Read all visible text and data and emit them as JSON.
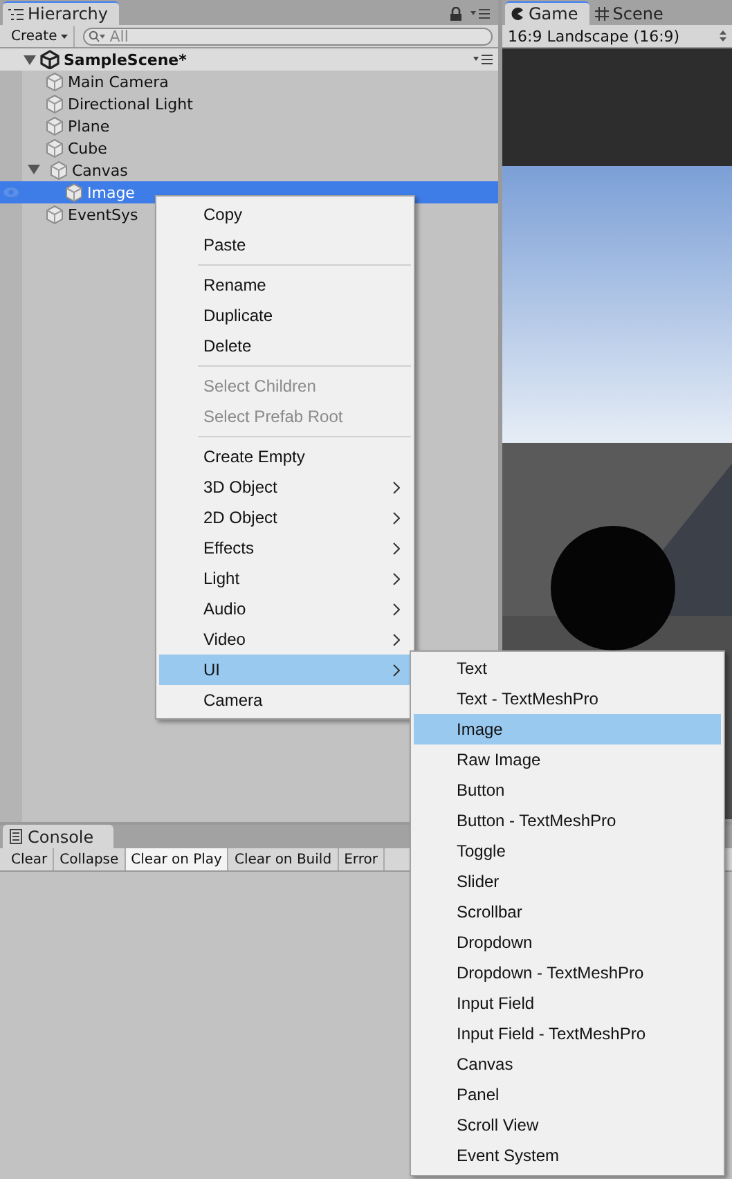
{
  "hierarchy": {
    "title": "Hierarchy",
    "create_button": "Create",
    "search_placeholder": "All",
    "scene": {
      "name": "SampleScene*",
      "expanded": true
    },
    "items": [
      {
        "label": "Main Camera",
        "selected": false
      },
      {
        "label": "Directional Light",
        "selected": false
      },
      {
        "label": "Plane",
        "selected": false
      },
      {
        "label": "Cube",
        "selected": false
      },
      {
        "label": "Canvas",
        "selected": false,
        "expanded": true,
        "children": [
          {
            "label": "Image",
            "selected": true
          }
        ]
      },
      {
        "label": "EventSys",
        "selected": false
      }
    ]
  },
  "game": {
    "tabs": [
      {
        "label": "Game",
        "kind": "game",
        "selected": true
      },
      {
        "label": "Scene",
        "kind": "scene",
        "selected": false
      }
    ],
    "aspect": "16:9 Landscape (16:9)"
  },
  "console": {
    "title": "Console",
    "buttons": [
      {
        "label": "Clear",
        "selected": false
      },
      {
        "label": "Collapse",
        "selected": false
      },
      {
        "label": "Clear on Play",
        "selected": true
      },
      {
        "label": "Clear on Build",
        "selected": false
      },
      {
        "label": "Error",
        "selected": false
      }
    ]
  },
  "context_menu": {
    "items": [
      {
        "kind": "item",
        "label": "Copy",
        "disabled": false,
        "submenu": false,
        "selected": false
      },
      {
        "kind": "item",
        "label": "Paste",
        "disabled": false,
        "submenu": false,
        "selected": false
      },
      {
        "kind": "separator"
      },
      {
        "kind": "item",
        "label": "Rename",
        "disabled": false,
        "submenu": false,
        "selected": false
      },
      {
        "kind": "item",
        "label": "Duplicate",
        "disabled": false,
        "submenu": false,
        "selected": false
      },
      {
        "kind": "item",
        "label": "Delete",
        "disabled": false,
        "submenu": false,
        "selected": false
      },
      {
        "kind": "separator"
      },
      {
        "kind": "item",
        "label": "Select Children",
        "disabled": true,
        "submenu": false,
        "selected": false
      },
      {
        "kind": "item",
        "label": "Select Prefab Root",
        "disabled": true,
        "submenu": false,
        "selected": false
      },
      {
        "kind": "separator"
      },
      {
        "kind": "item",
        "label": "Create Empty",
        "disabled": false,
        "submenu": false,
        "selected": false
      },
      {
        "kind": "item",
        "label": "3D Object",
        "disabled": false,
        "submenu": true,
        "selected": false
      },
      {
        "kind": "item",
        "label": "2D Object",
        "disabled": false,
        "submenu": true,
        "selected": false
      },
      {
        "kind": "item",
        "label": "Effects",
        "disabled": false,
        "submenu": true,
        "selected": false
      },
      {
        "kind": "item",
        "label": "Light",
        "disabled": false,
        "submenu": true,
        "selected": false
      },
      {
        "kind": "item",
        "label": "Audio",
        "disabled": false,
        "submenu": true,
        "selected": false
      },
      {
        "kind": "item",
        "label": "Video",
        "disabled": false,
        "submenu": true,
        "selected": false
      },
      {
        "kind": "item",
        "label": "UI",
        "disabled": false,
        "submenu": true,
        "selected": true
      },
      {
        "kind": "item",
        "label": "Camera",
        "disabled": false,
        "submenu": false,
        "selected": false
      }
    ]
  },
  "submenu": {
    "items": [
      {
        "label": "Text",
        "selected": false
      },
      {
        "label": "Text - TextMeshPro",
        "selected": false
      },
      {
        "label": "Image",
        "selected": true
      },
      {
        "label": "Raw Image",
        "selected": false
      },
      {
        "label": "Button",
        "selected": false
      },
      {
        "label": "Button - TextMeshPro",
        "selected": false
      },
      {
        "label": "Toggle",
        "selected": false
      },
      {
        "label": "Slider",
        "selected": false
      },
      {
        "label": "Scrollbar",
        "selected": false
      },
      {
        "label": "Dropdown",
        "selected": false
      },
      {
        "label": "Dropdown - TextMeshPro",
        "selected": false
      },
      {
        "label": "Input Field",
        "selected": false
      },
      {
        "label": "Input Field - TextMeshPro",
        "selected": false
      },
      {
        "label": "Canvas",
        "selected": false
      },
      {
        "label": "Panel",
        "selected": false
      },
      {
        "label": "Scroll View",
        "selected": false
      },
      {
        "label": "Event System",
        "selected": false
      }
    ]
  }
}
